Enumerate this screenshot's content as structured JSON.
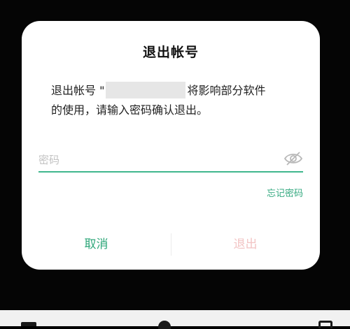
{
  "dialog": {
    "title": "退出帐号",
    "message_line1_prefix": "退出帐号 \"",
    "message_line1_suffix": "将影响部分软件",
    "message_line2": "的使用，请输入密码确认退出。",
    "password_placeholder": "密码",
    "password_value": "",
    "forgot_password_label": "忘记密码",
    "cancel_label": "取消",
    "exit_label": "退出"
  },
  "icons": {
    "password_visibility": "eye-off-icon",
    "nav_back": "back-icon",
    "nav_home": "home-icon",
    "nav_recent": "recent-apps-icon"
  },
  "colors": {
    "accent": "#3fb78d",
    "cancel_text": "#2fa77a",
    "exit_text_disabled": "#f2c4c4",
    "dialog_bg": "#ffffff",
    "backdrop": "#000000"
  }
}
